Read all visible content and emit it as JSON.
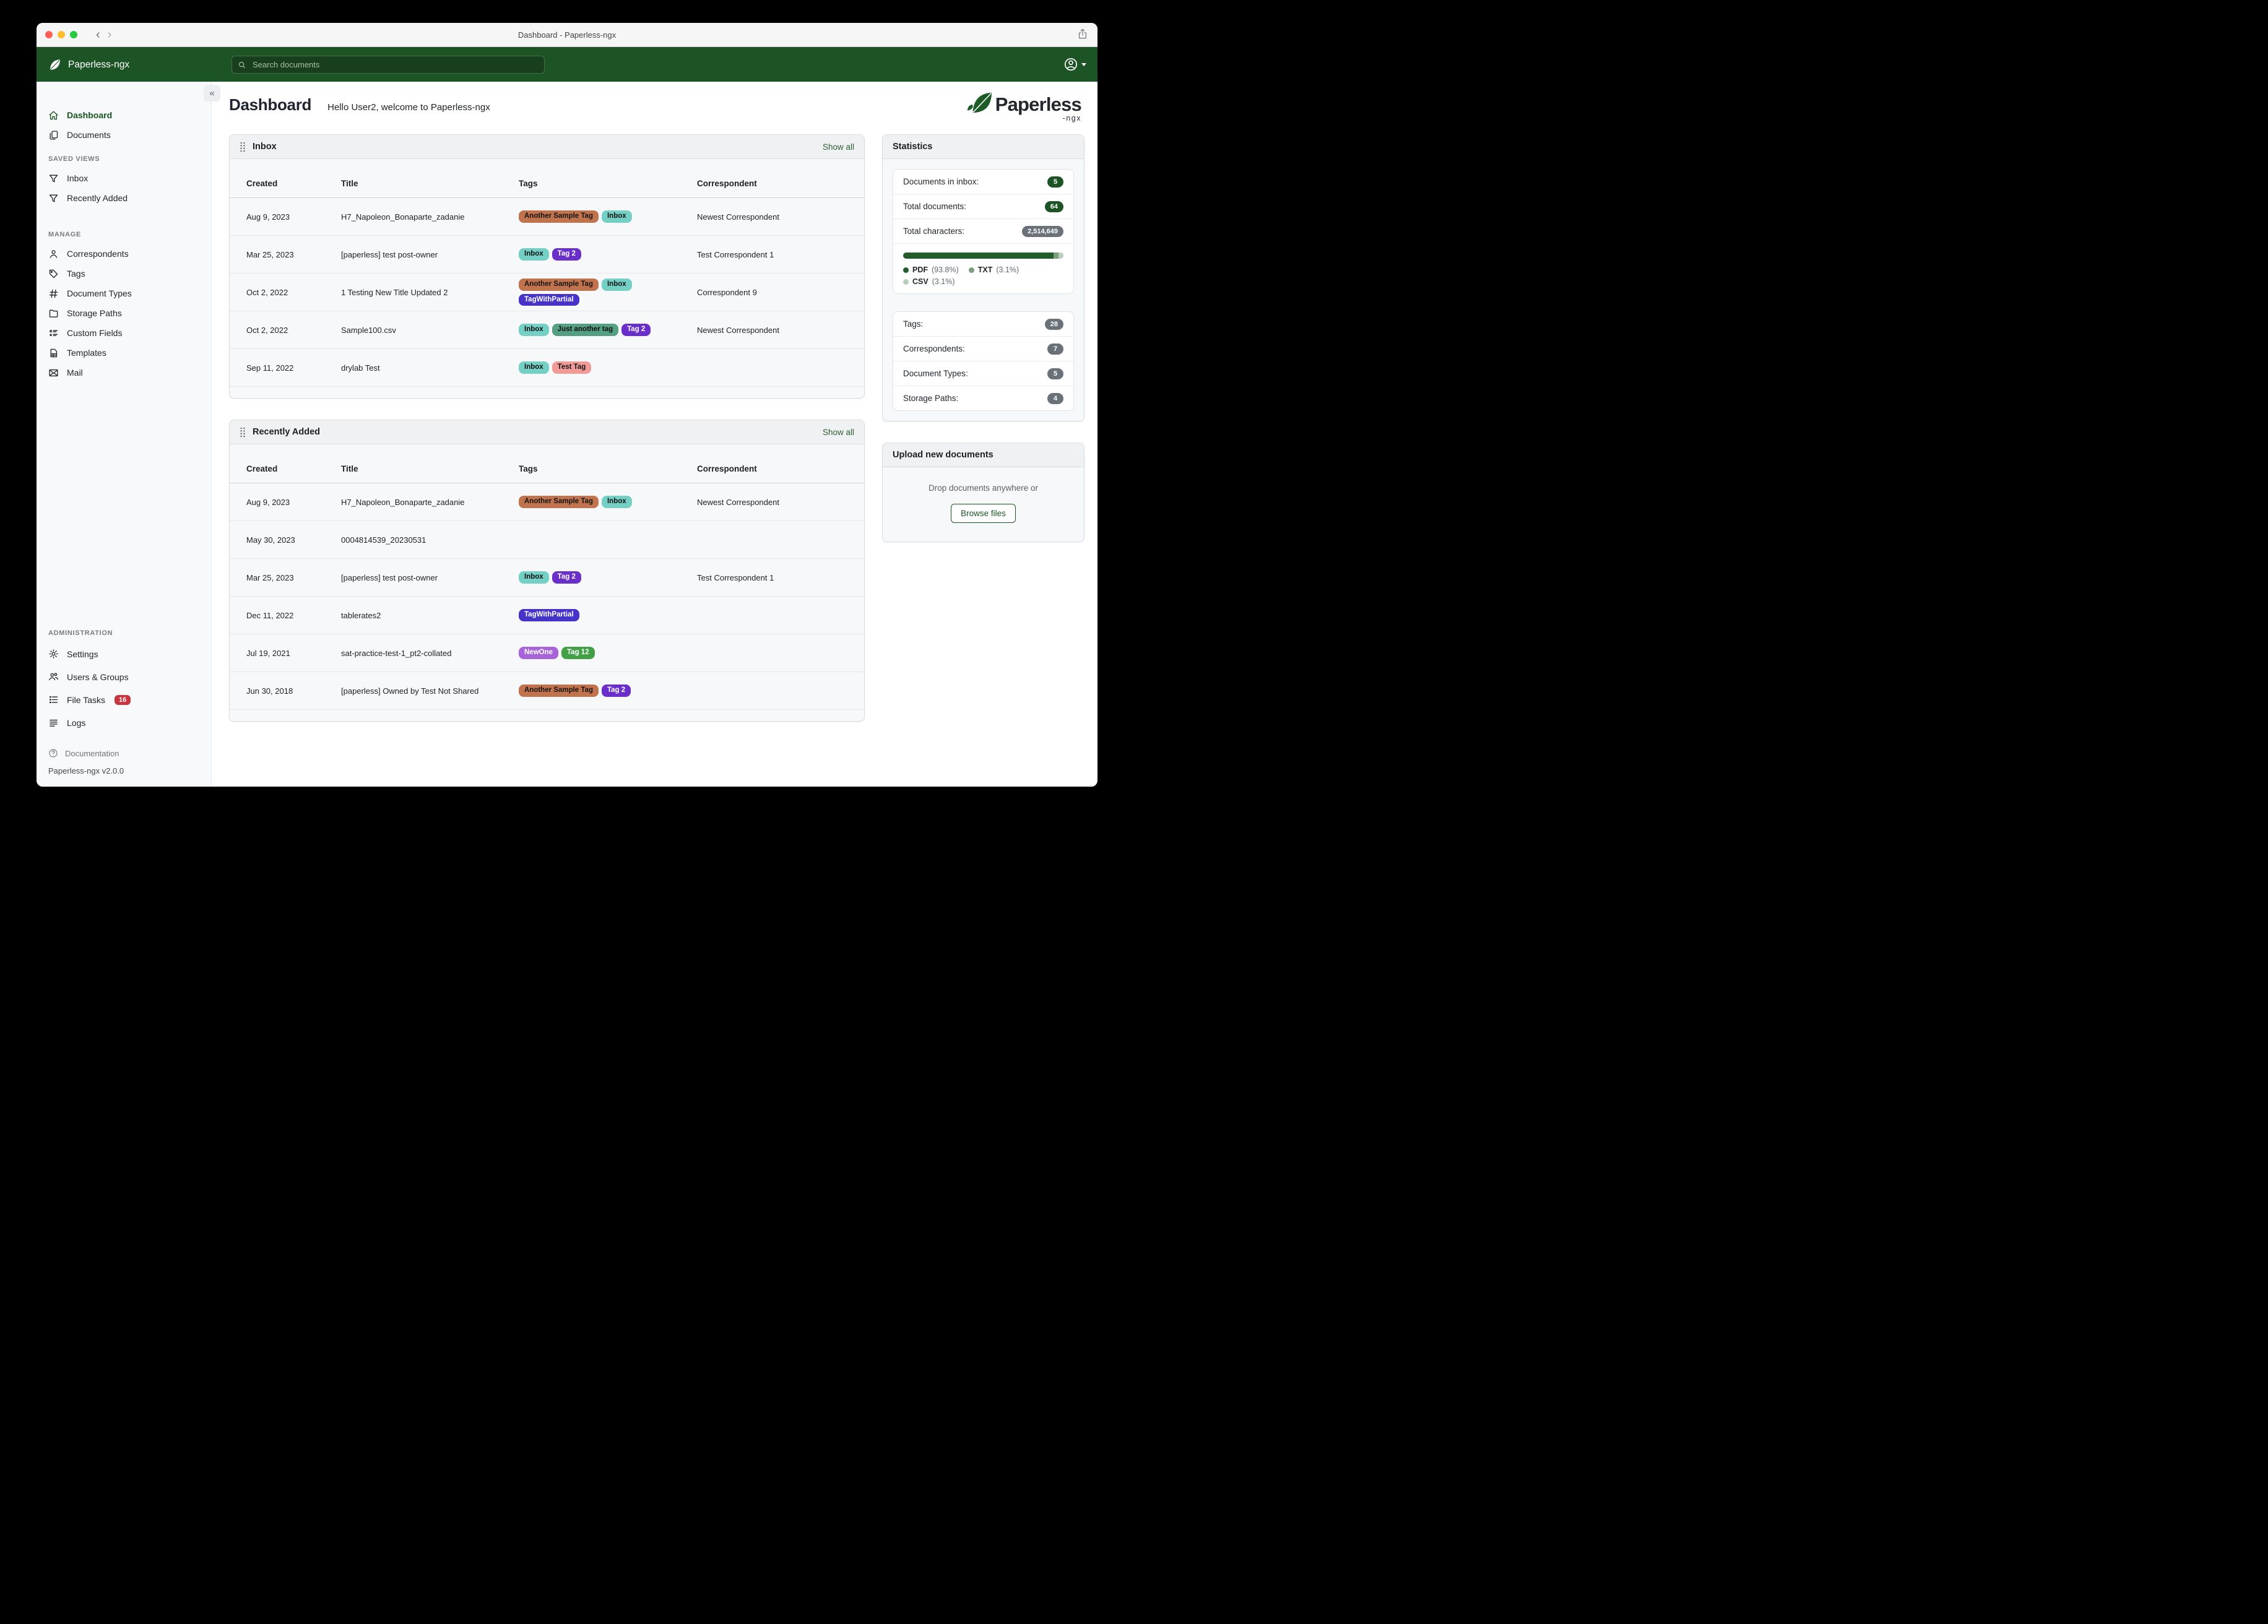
{
  "window": {
    "title": "Dashboard - Paperless-ngx"
  },
  "glyphs": {
    "back": "‹",
    "forward": "›",
    "collapse": "«"
  },
  "navbar": {
    "brand": "Paperless-ngx",
    "search_placeholder": "Search documents"
  },
  "page": {
    "title": "Dashboard",
    "greeting": "Hello User2, welcome to Paperless-ngx"
  },
  "logo": {
    "word": "Paperless",
    "suffix": "-ngx"
  },
  "sidebar": {
    "primary": [
      {
        "icon": "home-icon",
        "label": "Dashboard",
        "active": true
      },
      {
        "icon": "documents-icon",
        "label": "Documents"
      }
    ],
    "saved_views_heading": "SAVED VIEWS",
    "saved_views": [
      {
        "icon": "filter-icon",
        "label": "Inbox"
      },
      {
        "icon": "filter-icon",
        "label": "Recently Added"
      }
    ],
    "manage_heading": "MANAGE",
    "manage": [
      {
        "icon": "person-icon",
        "label": "Correspondents"
      },
      {
        "icon": "tag-icon",
        "label": "Tags"
      },
      {
        "icon": "hash-icon",
        "label": "Document Types"
      },
      {
        "icon": "folder-icon",
        "label": "Storage Paths"
      },
      {
        "icon": "custom-fields-icon",
        "label": "Custom Fields"
      },
      {
        "icon": "templates-icon",
        "label": "Templates"
      },
      {
        "icon": "mail-icon",
        "label": "Mail"
      }
    ],
    "administration_heading": "ADMINISTRATION",
    "administration": [
      {
        "icon": "gear-icon",
        "label": "Settings"
      },
      {
        "icon": "users-icon",
        "label": "Users & Groups"
      },
      {
        "icon": "tasks-icon",
        "label": "File Tasks",
        "badge": "16"
      },
      {
        "icon": "logs-icon",
        "label": "Logs"
      }
    ],
    "documentation": "Documentation",
    "version": "Paperless-ngx v2.0.0"
  },
  "tags": {
    "Another Sample Tag": {
      "bg": "#c0734c",
      "fg": "#141414"
    },
    "Inbox": {
      "bg": "#74d0c5",
      "fg": "#101010"
    },
    "Tag 2": {
      "bg": "#6b2fc9",
      "fg": "#ffffff"
    },
    "TagWithPartial": {
      "bg": "#4633c8",
      "fg": "#ffffff"
    },
    "Just another tag": {
      "bg": "#53a083",
      "fg": "#101010"
    },
    "Test Tag": {
      "bg": "#f09b97",
      "fg": "#141414"
    },
    "NewOne": {
      "bg": "#a763d8",
      "fg": "#ffffff"
    },
    "Tag 12": {
      "bg": "#43a047",
      "fg": "#ffffff"
    }
  },
  "widgets": {
    "inbox": {
      "title": "Inbox",
      "show_all": "Show all",
      "columns": [
        "Created",
        "Title",
        "Tags",
        "Correspondent"
      ],
      "rows": [
        {
          "created": "Aug 9, 2023",
          "title": "H7_Napoleon_Bonaparte_zadanie",
          "tags": [
            "Another Sample Tag",
            "Inbox"
          ],
          "correspondent": "Newest Correspondent"
        },
        {
          "created": "Mar 25, 2023",
          "title": "[paperless] test post-owner",
          "tags": [
            "Inbox",
            "Tag 2"
          ],
          "correspondent": "Test Correspondent 1"
        },
        {
          "created": "Oct 2, 2022",
          "title": "1 Testing New Title Updated 2",
          "tags": [
            "Another Sample Tag",
            "Inbox",
            "TagWithPartial"
          ],
          "correspondent": "Correspondent 9"
        },
        {
          "created": "Oct 2, 2022",
          "title": "Sample100.csv",
          "tags": [
            "Inbox",
            "Just another tag",
            "Tag 2"
          ],
          "correspondent": "Newest Correspondent"
        },
        {
          "created": "Sep 11, 2022",
          "title": "drylab Test",
          "tags": [
            "Inbox",
            "Test Tag"
          ],
          "correspondent": ""
        }
      ]
    },
    "recently_added": {
      "title": "Recently Added",
      "show_all": "Show all",
      "columns": [
        "Created",
        "Title",
        "Tags",
        "Correspondent"
      ],
      "rows": [
        {
          "created": "Aug 9, 2023",
          "title": "H7_Napoleon_Bonaparte_zadanie",
          "tags": [
            "Another Sample Tag",
            "Inbox"
          ],
          "correspondent": "Newest Correspondent"
        },
        {
          "created": "May 30, 2023",
          "title": "0004814539_20230531",
          "tags": [],
          "correspondent": ""
        },
        {
          "created": "Mar 25, 2023",
          "title": "[paperless] test post-owner",
          "tags": [
            "Inbox",
            "Tag 2"
          ],
          "correspondent": "Test Correspondent 1"
        },
        {
          "created": "Dec 11, 2022",
          "title": "tablerates2",
          "tags": [
            "TagWithPartial"
          ],
          "correspondent": ""
        },
        {
          "created": "Jul 19, 2021",
          "title": "sat-practice-test-1_pt2-collated",
          "tags": [
            "NewOne",
            "Tag 12"
          ],
          "correspondent": ""
        },
        {
          "created": "Jun 30, 2018",
          "title": "[paperless] Owned by Test Not Shared",
          "tags": [
            "Another Sample Tag",
            "Tag 2"
          ],
          "correspondent": ""
        }
      ]
    }
  },
  "statistics": {
    "title": "Statistics",
    "rows": [
      {
        "label": "Documents in inbox:",
        "value": "5",
        "style": "green"
      },
      {
        "label": "Total documents:",
        "value": "64",
        "style": "green"
      },
      {
        "label": "Total characters:",
        "value": "2,514,649",
        "style": "gray"
      }
    ],
    "file_types": [
      {
        "label": "PDF",
        "pct": 93.8,
        "pct_text": "(93.8%)",
        "color": "#235c2b"
      },
      {
        "label": "TXT",
        "pct": 3.1,
        "pct_text": "(3.1%)",
        "color": "#7d9d80"
      },
      {
        "label": "CSV",
        "pct": 3.1,
        "pct_text": "(3.1%)",
        "color": "#b9cdbb"
      }
    ],
    "counts": [
      {
        "label": "Tags:",
        "value": "28"
      },
      {
        "label": "Correspondents:",
        "value": "7"
      },
      {
        "label": "Document Types:",
        "value": "5"
      },
      {
        "label": "Storage Paths:",
        "value": "4"
      }
    ]
  },
  "upload": {
    "title": "Upload new documents",
    "hint": "Drop documents anywhere or",
    "button": "Browse files"
  }
}
